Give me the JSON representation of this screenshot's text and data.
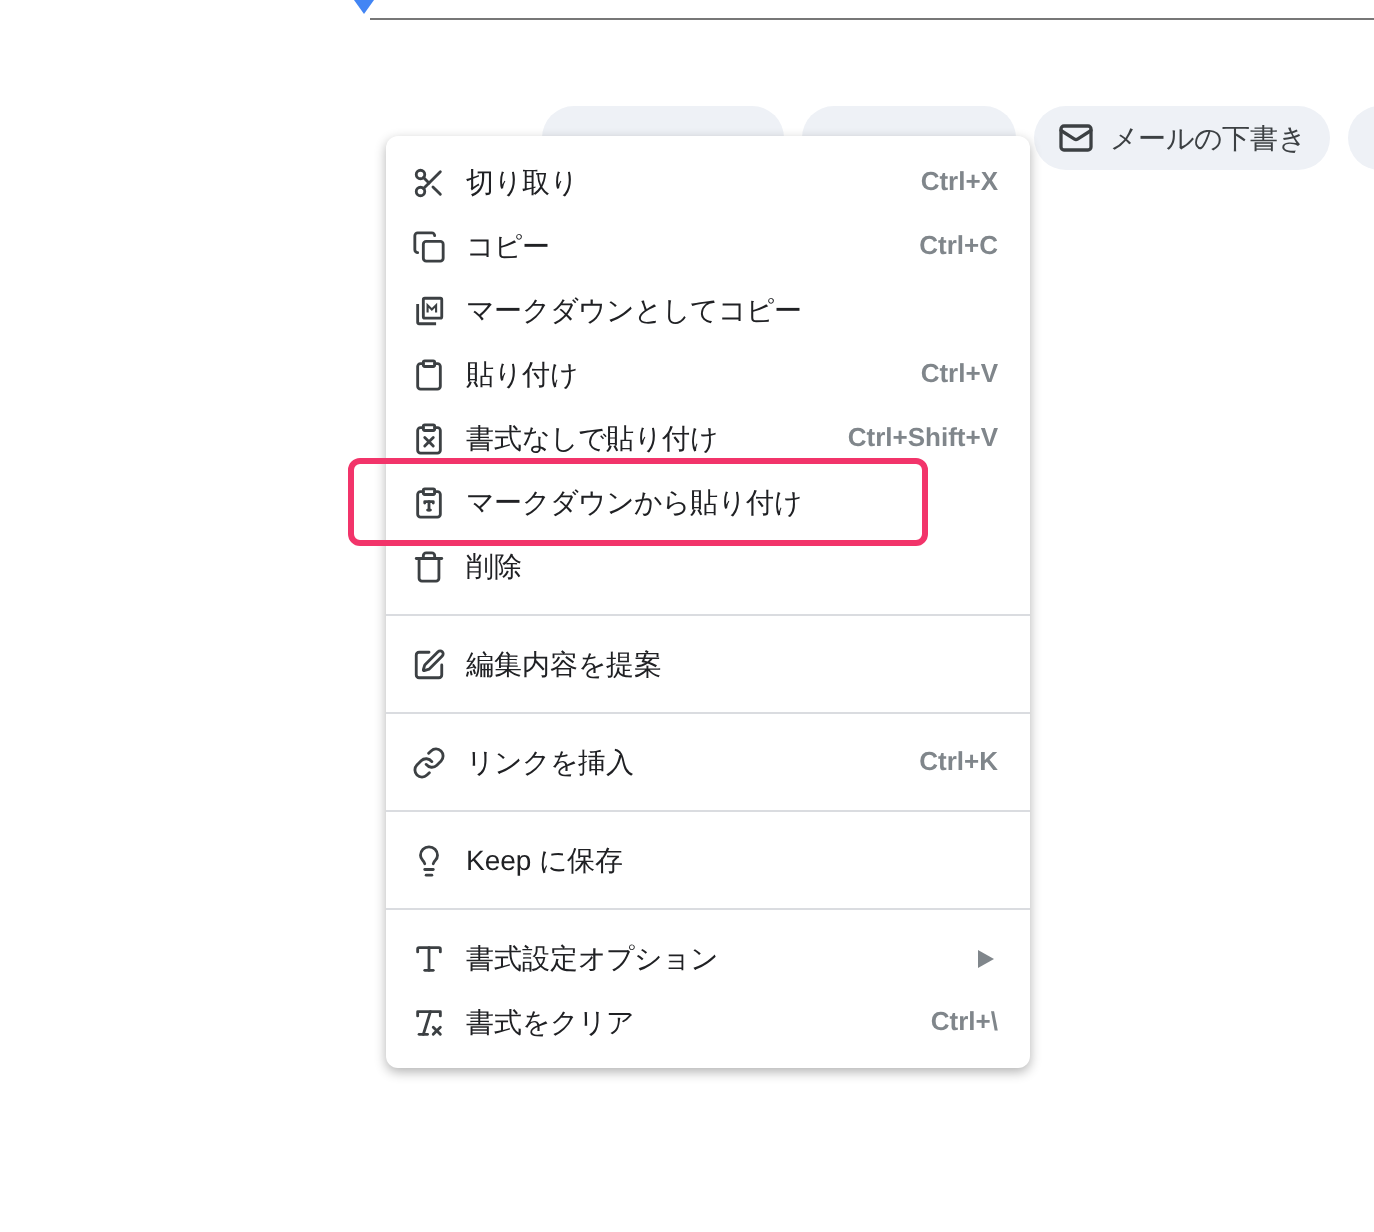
{
  "chips": [
    {
      "label": "メールの下書き"
    }
  ],
  "context_menu": {
    "sections": [
      {
        "items": [
          {
            "label": "切り取り",
            "shortcut": "Ctrl+X",
            "highlighted": false
          },
          {
            "label": "コピー",
            "shortcut": "Ctrl+C",
            "highlighted": false
          },
          {
            "label": "マークダウンとしてコピー",
            "highlighted": false
          },
          {
            "label": "貼り付け",
            "shortcut": "Ctrl+V",
            "highlighted": false
          },
          {
            "label": "書式なしで貼り付け",
            "shortcut": "Ctrl+Shift+V",
            "highlighted": false
          },
          {
            "label": "マークダウンから貼り付け",
            "highlighted": true
          },
          {
            "label": "削除",
            "highlighted": false
          }
        ]
      },
      {
        "items": [
          {
            "label": "編集内容を提案",
            "highlighted": false
          }
        ]
      },
      {
        "items": [
          {
            "label": "リンクを挿入",
            "shortcut": "Ctrl+K",
            "highlighted": false
          }
        ]
      },
      {
        "items": [
          {
            "label": "Keep に保存",
            "highlighted": false
          }
        ]
      },
      {
        "items": [
          {
            "label": "書式設定オプション",
            "submenu": true,
            "highlighted": false
          },
          {
            "label": "書式をクリア",
            "shortcut": "Ctrl+\\",
            "highlighted": false
          }
        ]
      }
    ]
  }
}
